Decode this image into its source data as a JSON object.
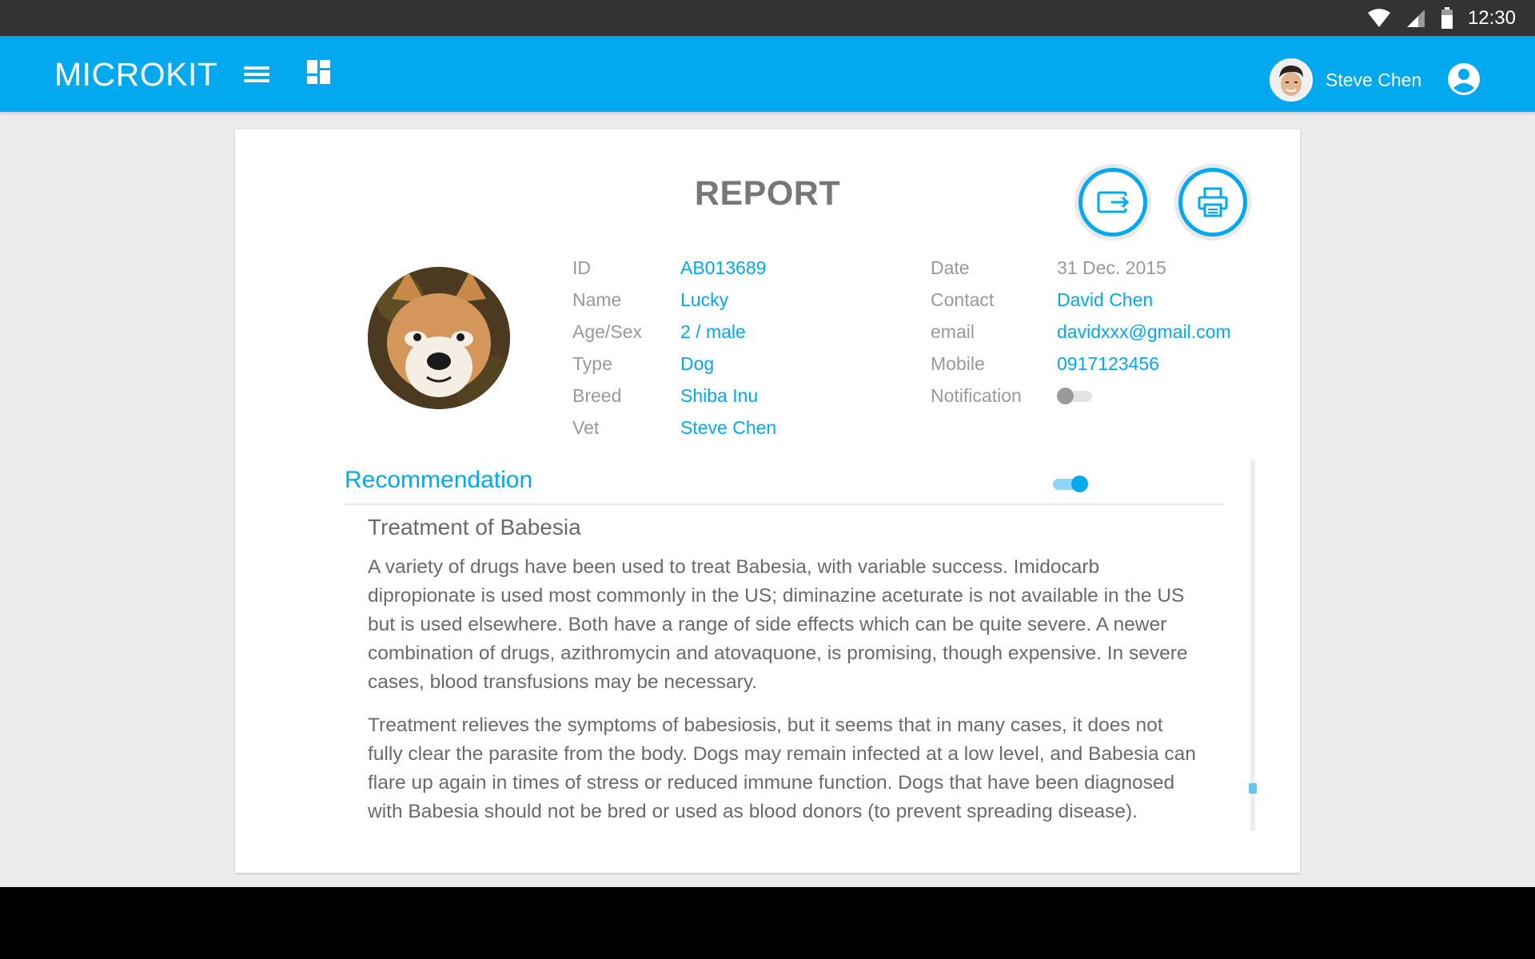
{
  "status_bar": {
    "time": "12:30",
    "icons": [
      "wifi-icon",
      "cell-signal-icon",
      "battery-icon"
    ]
  },
  "app_bar": {
    "title": "MICROKIT",
    "menu_icon": "menu-icon",
    "dashboard_icon": "dashboard-icon",
    "user_name": "Steve Chen",
    "account_icon": "account-circle-icon"
  },
  "report": {
    "title": "REPORT",
    "actions": [
      "export-icon",
      "print-icon"
    ],
    "pet": {
      "fields": [
        {
          "label": "ID",
          "value": "AB013689"
        },
        {
          "label": "Name",
          "value": "Lucky"
        },
        {
          "label": "Age/Sex",
          "value": "2 / male"
        },
        {
          "label": "Type",
          "value": "Dog"
        },
        {
          "label": "Breed",
          "value": "Shiba Inu"
        },
        {
          "label": "Vet",
          "value": "Steve Chen"
        }
      ]
    },
    "owner": {
      "fields": [
        {
          "label": "Date",
          "value": "31 Dec. 2015"
        },
        {
          "label": "Contact",
          "value": "David Chen"
        },
        {
          "label": "email",
          "value": "davidxxx@gmail.com"
        },
        {
          "label": "Mobile",
          "value": "0917123456"
        }
      ],
      "notification_label": "Notification",
      "notification_on": false
    },
    "recommendation": {
      "title": "Recommendation",
      "toggle_on": true,
      "heading": "Treatment of Babesia",
      "paragraphs": [
        "A variety of drugs have been used to treat Babesia, with variable success. Imidocarb dipropionate is used most commonly in the US; diminazine aceturate is not available in the US but is used elsewhere. Both have a range of side effects which can be quite severe. A newer combination of drugs, azithromycin and atovaquone, is promising, though expensive. In severe cases, blood transfusions may be necessary.",
        "Treatment relieves the symptoms of babesiosis, but it seems that in many cases, it does not fully clear the parasite from the body. Dogs may remain infected at a low level, and Babesia can flare up again in times of stress or reduced immune function. Dogs that have been diagnosed with Babesia should not be bred or used as blood donors (to prevent spreading disease)."
      ]
    }
  },
  "colors": {
    "primary": "#03a9ee",
    "status_bar": "#333333",
    "label": "#999999",
    "body_text": "#6a6a6a",
    "title_text": "#777777"
  }
}
